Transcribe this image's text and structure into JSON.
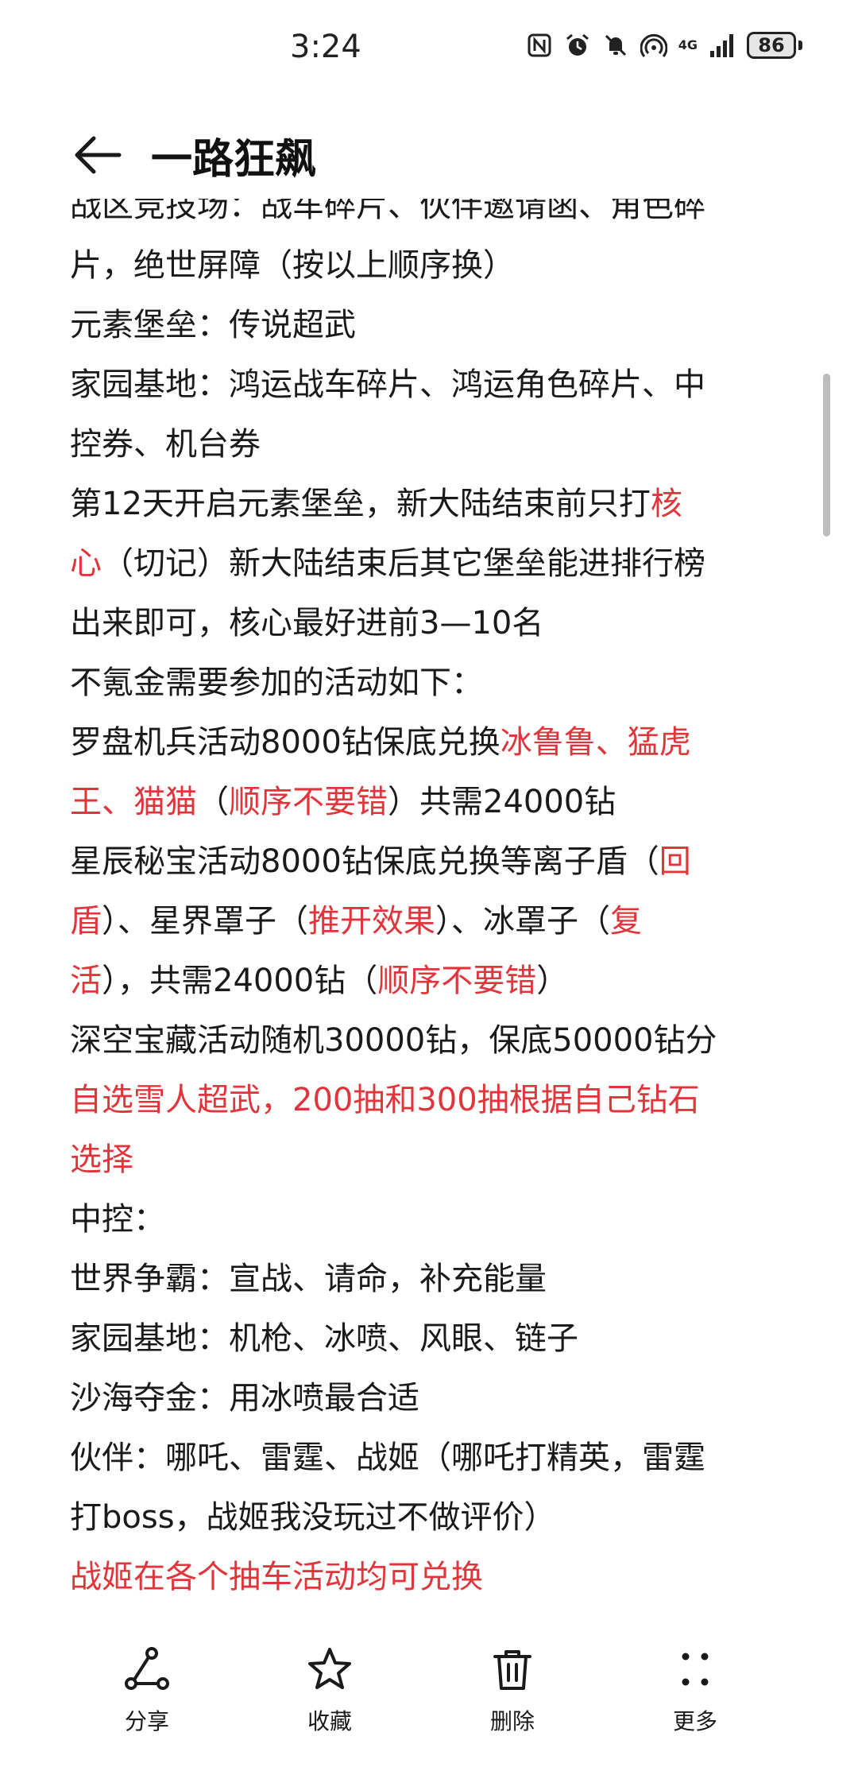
{
  "status": {
    "time": "3:24",
    "network": "4G",
    "battery": "86"
  },
  "header": {
    "title": "一路狂飙"
  },
  "article": {
    "lines": [
      [
        {
          "t": "战区竞技场：战车碎片、伙伴邀请函、角色碎"
        }
      ],
      [
        {
          "t": "片，绝世屏障（按以上顺序换）"
        }
      ],
      [
        {
          "t": "元素堡垒：传说超武"
        }
      ],
      [
        {
          "t": "家园基地：鸿运战车碎片、鸿运角色碎片、中"
        }
      ],
      [
        {
          "t": "控券、机台券"
        }
      ],
      [
        {
          "t": "第12天开启元素堡垒，新大陆结束前只打"
        },
        {
          "t": "核",
          "red": true
        }
      ],
      [
        {
          "t": "心",
          "red": true
        },
        {
          "t": "（切记）新大陆结束后其它堡垒能进排行榜"
        }
      ],
      [
        {
          "t": "出来即可，核心最好进前3—10名"
        }
      ],
      [
        {
          "t": "不氪金需要参加的活动如下："
        }
      ],
      [
        {
          "t": "罗盘机兵活动8000钻保底兑换"
        },
        {
          "t": "冰鲁鲁、猛虎",
          "red": true
        }
      ],
      [
        {
          "t": "王、猫猫",
          "red": true
        },
        {
          "t": "（"
        },
        {
          "t": "顺序不要错",
          "red": true
        },
        {
          "t": "）共需24000钻"
        }
      ],
      [
        {
          "t": "星辰秘宝活动8000钻保底兑换等离子盾（"
        },
        {
          "t": "回",
          "red": true
        }
      ],
      [
        {
          "t": "盾",
          "red": true
        },
        {
          "t": "）、星界罩子（"
        },
        {
          "t": "推开效果",
          "red": true
        },
        {
          "t": "）、冰罩子（"
        },
        {
          "t": "复",
          "red": true
        }
      ],
      [
        {
          "t": "活",
          "red": true
        },
        {
          "t": "），共需24000钻（"
        },
        {
          "t": "顺序不要错",
          "red": true
        },
        {
          "t": "）"
        }
      ],
      [
        {
          "t": "深空宝藏活动随机30000钻，保底50000钻分"
        }
      ],
      [
        {
          "t": "自选雪人超武，200抽和300抽根据自己钻石",
          "red": true
        }
      ],
      [
        {
          "t": "选择",
          "red": true
        }
      ],
      [
        {
          "t": "中控："
        }
      ],
      [
        {
          "t": "世界争霸：宣战、请命，补充能量"
        }
      ],
      [
        {
          "t": "家园基地：机枪、冰喷、风眼、链子"
        }
      ],
      [
        {
          "t": "沙海夺金：用冰喷最合适"
        }
      ],
      [
        {
          "t": "伙伴：哪吒、雷霆、战姬（哪吒打精英，雷霆"
        }
      ],
      [
        {
          "t": "打boss，战姬我没玩过不做评价）"
        }
      ],
      [
        {
          "t": " 战姬在各个抽车活动均可兑换",
          "red": true
        }
      ]
    ]
  },
  "toolbar": {
    "share_label": "分享",
    "favorite_label": "收藏",
    "delete_label": "删除",
    "more_label": "更多"
  },
  "colors": {
    "highlight": "#e0353b",
    "text": "#1a1a1a"
  }
}
